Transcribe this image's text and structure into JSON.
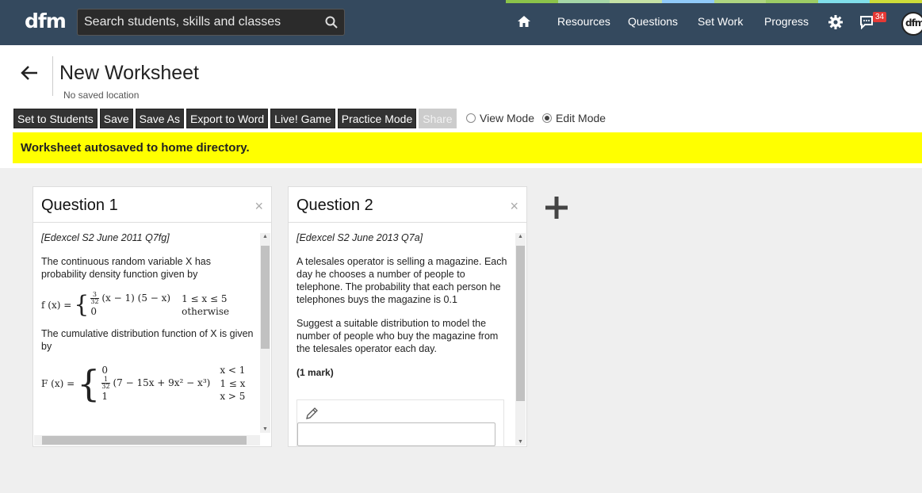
{
  "nav": {
    "logo": "dfm",
    "search_placeholder": "Search students, skills and classes",
    "items": [
      "Resources",
      "Questions",
      "Set Work",
      "Progress"
    ],
    "notification_count": "34",
    "avatar_text": "dfm",
    "stripe_colors": [
      "#8bc34a",
      "#a5d6a7",
      "#c5e1a5",
      "#90caf9",
      "#aed581",
      "#9ccc65",
      "#80deea",
      "#cddc39"
    ]
  },
  "header": {
    "title": "New Worksheet",
    "location": "No saved location",
    "toolbar": [
      "Set to Students",
      "Save",
      "Save As",
      "Export to Word",
      "Live! Game",
      "Practice Mode",
      "Share"
    ],
    "modes": {
      "view": "View Mode",
      "edit": "Edit Mode",
      "selected": "edit"
    },
    "banner": "Worksheet autosaved to home directory."
  },
  "questions": [
    {
      "title": "Question 1",
      "source": "[Edexcel S2 June 2011 Q7fg]",
      "text1": "The continuous random variable X has probability density function given by",
      "pdf_lhs": "f (x) =",
      "pdf_case1_expr": "(x − 1) (5 − x)",
      "pdf_case1_cond": "1 ≤ x ≤ 5",
      "pdf_case2_expr": "0",
      "pdf_case2_cond": "otherwise",
      "frac_num": "3",
      "frac_den": "32",
      "text2": "The cumulative distribution function of X is given by",
      "cdf_lhs": "F (x) =",
      "cdf_case1_expr": "0",
      "cdf_case1_cond": "x < 1",
      "cdf_case2_expr": "(7 − 15x + 9x² − x³)",
      "cdf_case2_cond": "1 ≤ x",
      "cdf_case3_expr": "1",
      "cdf_case3_cond": "x > 5",
      "cdf_frac_num": "1",
      "cdf_frac_den": "32"
    },
    {
      "title": "Question 2",
      "source": "[Edexcel S2 June 2013 Q7a]",
      "text1": "A telesales operator is selling a magazine. Each day he chooses a number of people to telephone. The probability that each person he telephones buys the magazine is 0.1",
      "text2": "Suggest a suitable distribution to model the number of people who buy the magazine from the telesales operator each day.",
      "marks": "(1 mark)"
    }
  ]
}
